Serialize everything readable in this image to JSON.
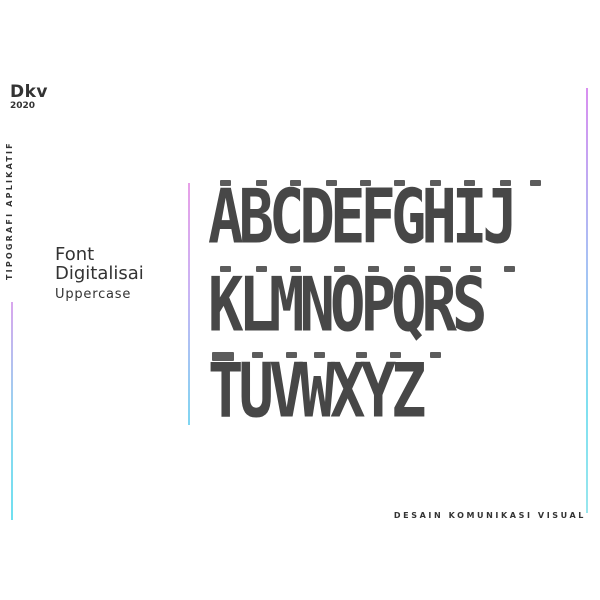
{
  "brand": {
    "title": "Dkv",
    "year": "2020"
  },
  "side_label": "TIPOGRAFI APLIKATIF",
  "font_heading": {
    "name_line1": "Font",
    "name_line2": "Digitalisai",
    "case": "Uppercase"
  },
  "alphabet": {
    "row1": "ABCDEFGHIJ",
    "row2": "KLMNOPQRS",
    "row3": "TUVWXYZ"
  },
  "footer_label": "DESAIN KOMUNIKASI VISUAL",
  "colors": {
    "text": "#333333",
    "glyph": "#474747",
    "accent_pink": "#d98ff0",
    "accent_cyan": "#7fe0f0"
  }
}
